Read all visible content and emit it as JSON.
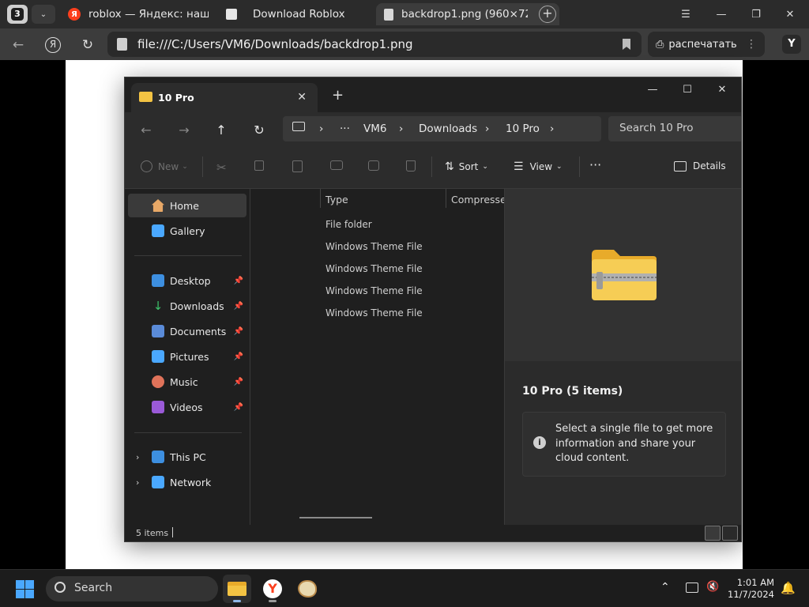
{
  "browser": {
    "tab_count": "3",
    "tabs": [
      {
        "title": "roblox — Яндекс: нашлось"
      },
      {
        "title": "Download Roblox"
      },
      {
        "title": "backdrop1.png (960×72"
      }
    ],
    "url": "file:///C:/Users/VM6/Downloads/backdrop1.png",
    "print_label": "распечатать"
  },
  "explorer": {
    "tab_title": "10 Pro",
    "breadcrumb": [
      "VM6",
      "Downloads",
      "10 Pro"
    ],
    "search_placeholder": "Search 10 Pro",
    "commands": {
      "new": "New",
      "sort": "Sort",
      "view": "View",
      "details": "Details"
    },
    "nav_pane": {
      "home": "Home",
      "gallery": "Gallery",
      "quick_access": [
        "Desktop",
        "Downloads",
        "Documents",
        "Pictures",
        "Music",
        "Videos"
      ],
      "this_pc": "This PC",
      "network": "Network"
    },
    "columns": {
      "type": "Type",
      "compressed": "Compressed"
    },
    "rows": [
      "File folder",
      "Windows Theme File",
      "Windows Theme File",
      "Windows Theme File",
      "Windows Theme File"
    ],
    "preview": {
      "title": "10 Pro (5 items)",
      "info": "Select a single file to get more information and share your cloud content."
    },
    "status": "5 items"
  },
  "taskbar": {
    "search_label": "Search",
    "time": "1:01 AM",
    "date": "11/7/2024"
  },
  "colors": {
    "accent_folder": "#f3c343",
    "windows_blue": "#4aa8ff",
    "yandex_red": "#fc3f1d"
  }
}
